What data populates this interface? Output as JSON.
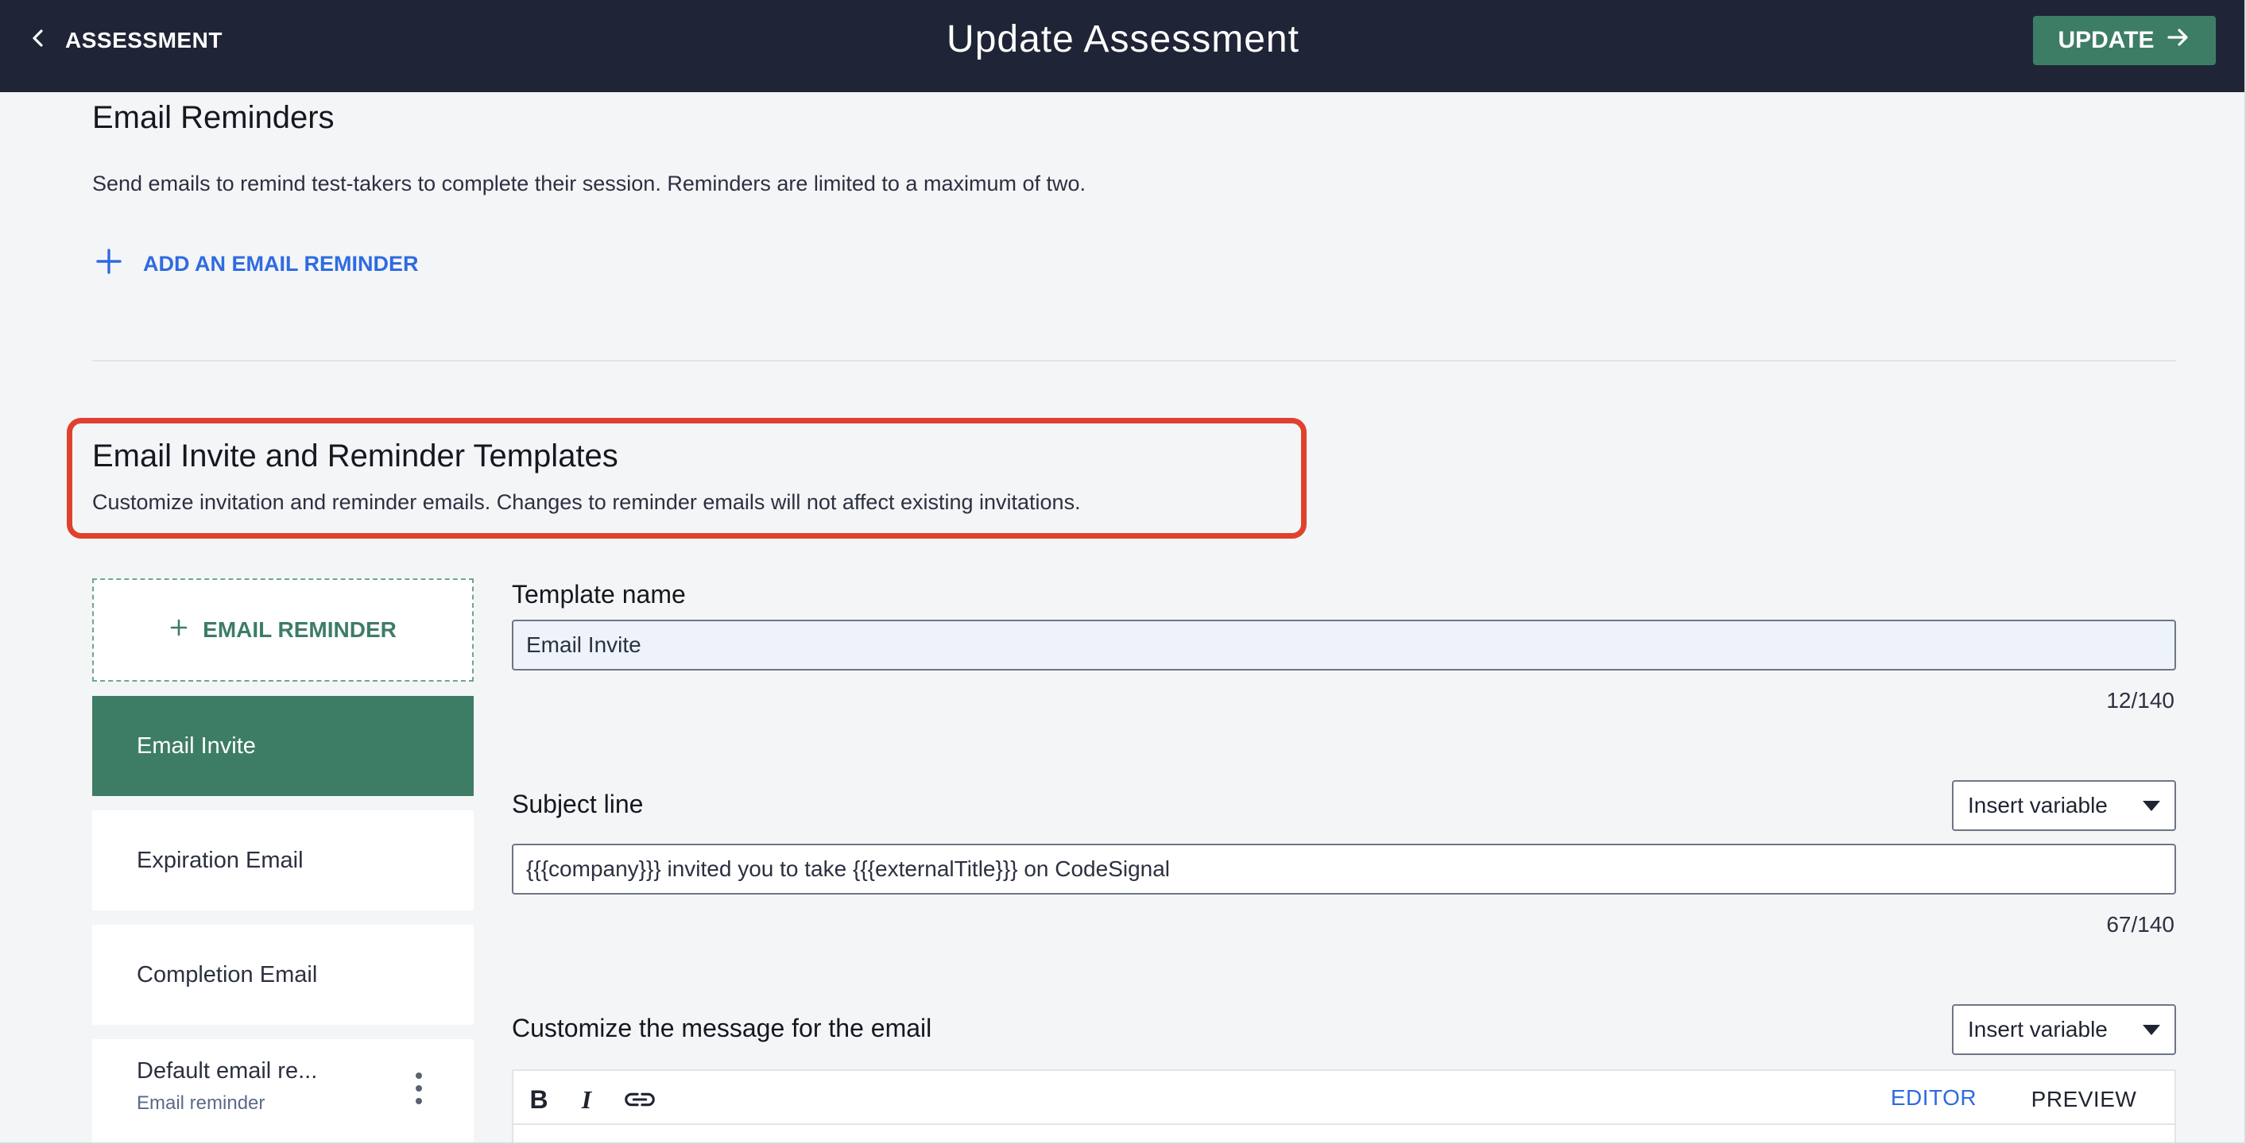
{
  "header": {
    "back_label": "ASSESSMENT",
    "title": "Update Assessment",
    "update_label": "UPDATE"
  },
  "email_reminders": {
    "title": "Email Reminders",
    "description": "Send emails to remind test-takers to complete their session. Reminders are limited to a maximum of two.",
    "add_label": "ADD AN EMAIL REMINDER"
  },
  "templates_section": {
    "title": "Email Invite and Reminder Templates",
    "description": "Customize invitation and reminder emails. Changes to reminder emails will not affect existing invitations."
  },
  "sidebar": {
    "add_label": "EMAIL REMINDER",
    "items": [
      {
        "label": "Email Invite"
      },
      {
        "label": "Expiration Email"
      },
      {
        "label": "Completion Email"
      },
      {
        "label": "Default email re...",
        "sub": "Email reminder"
      }
    ]
  },
  "form": {
    "template_name_label": "Template name",
    "template_name_value": "Email Invite",
    "template_name_count": "12/140",
    "subject_label": "Subject line",
    "subject_value": "{{{company}}} invited you to take {{{externalTitle}}} on CodeSignal",
    "subject_count": "67/140",
    "insert_variable_label": "Insert variable",
    "message_label": "Customize the message for the email",
    "editor_tab_label": "EDITOR",
    "preview_tab_label": "PREVIEW"
  },
  "colors": {
    "header_bg": "#1f2536",
    "accent_green": "#3d7d65",
    "link_blue": "#2f6be0",
    "highlight_red": "#e0412f"
  }
}
